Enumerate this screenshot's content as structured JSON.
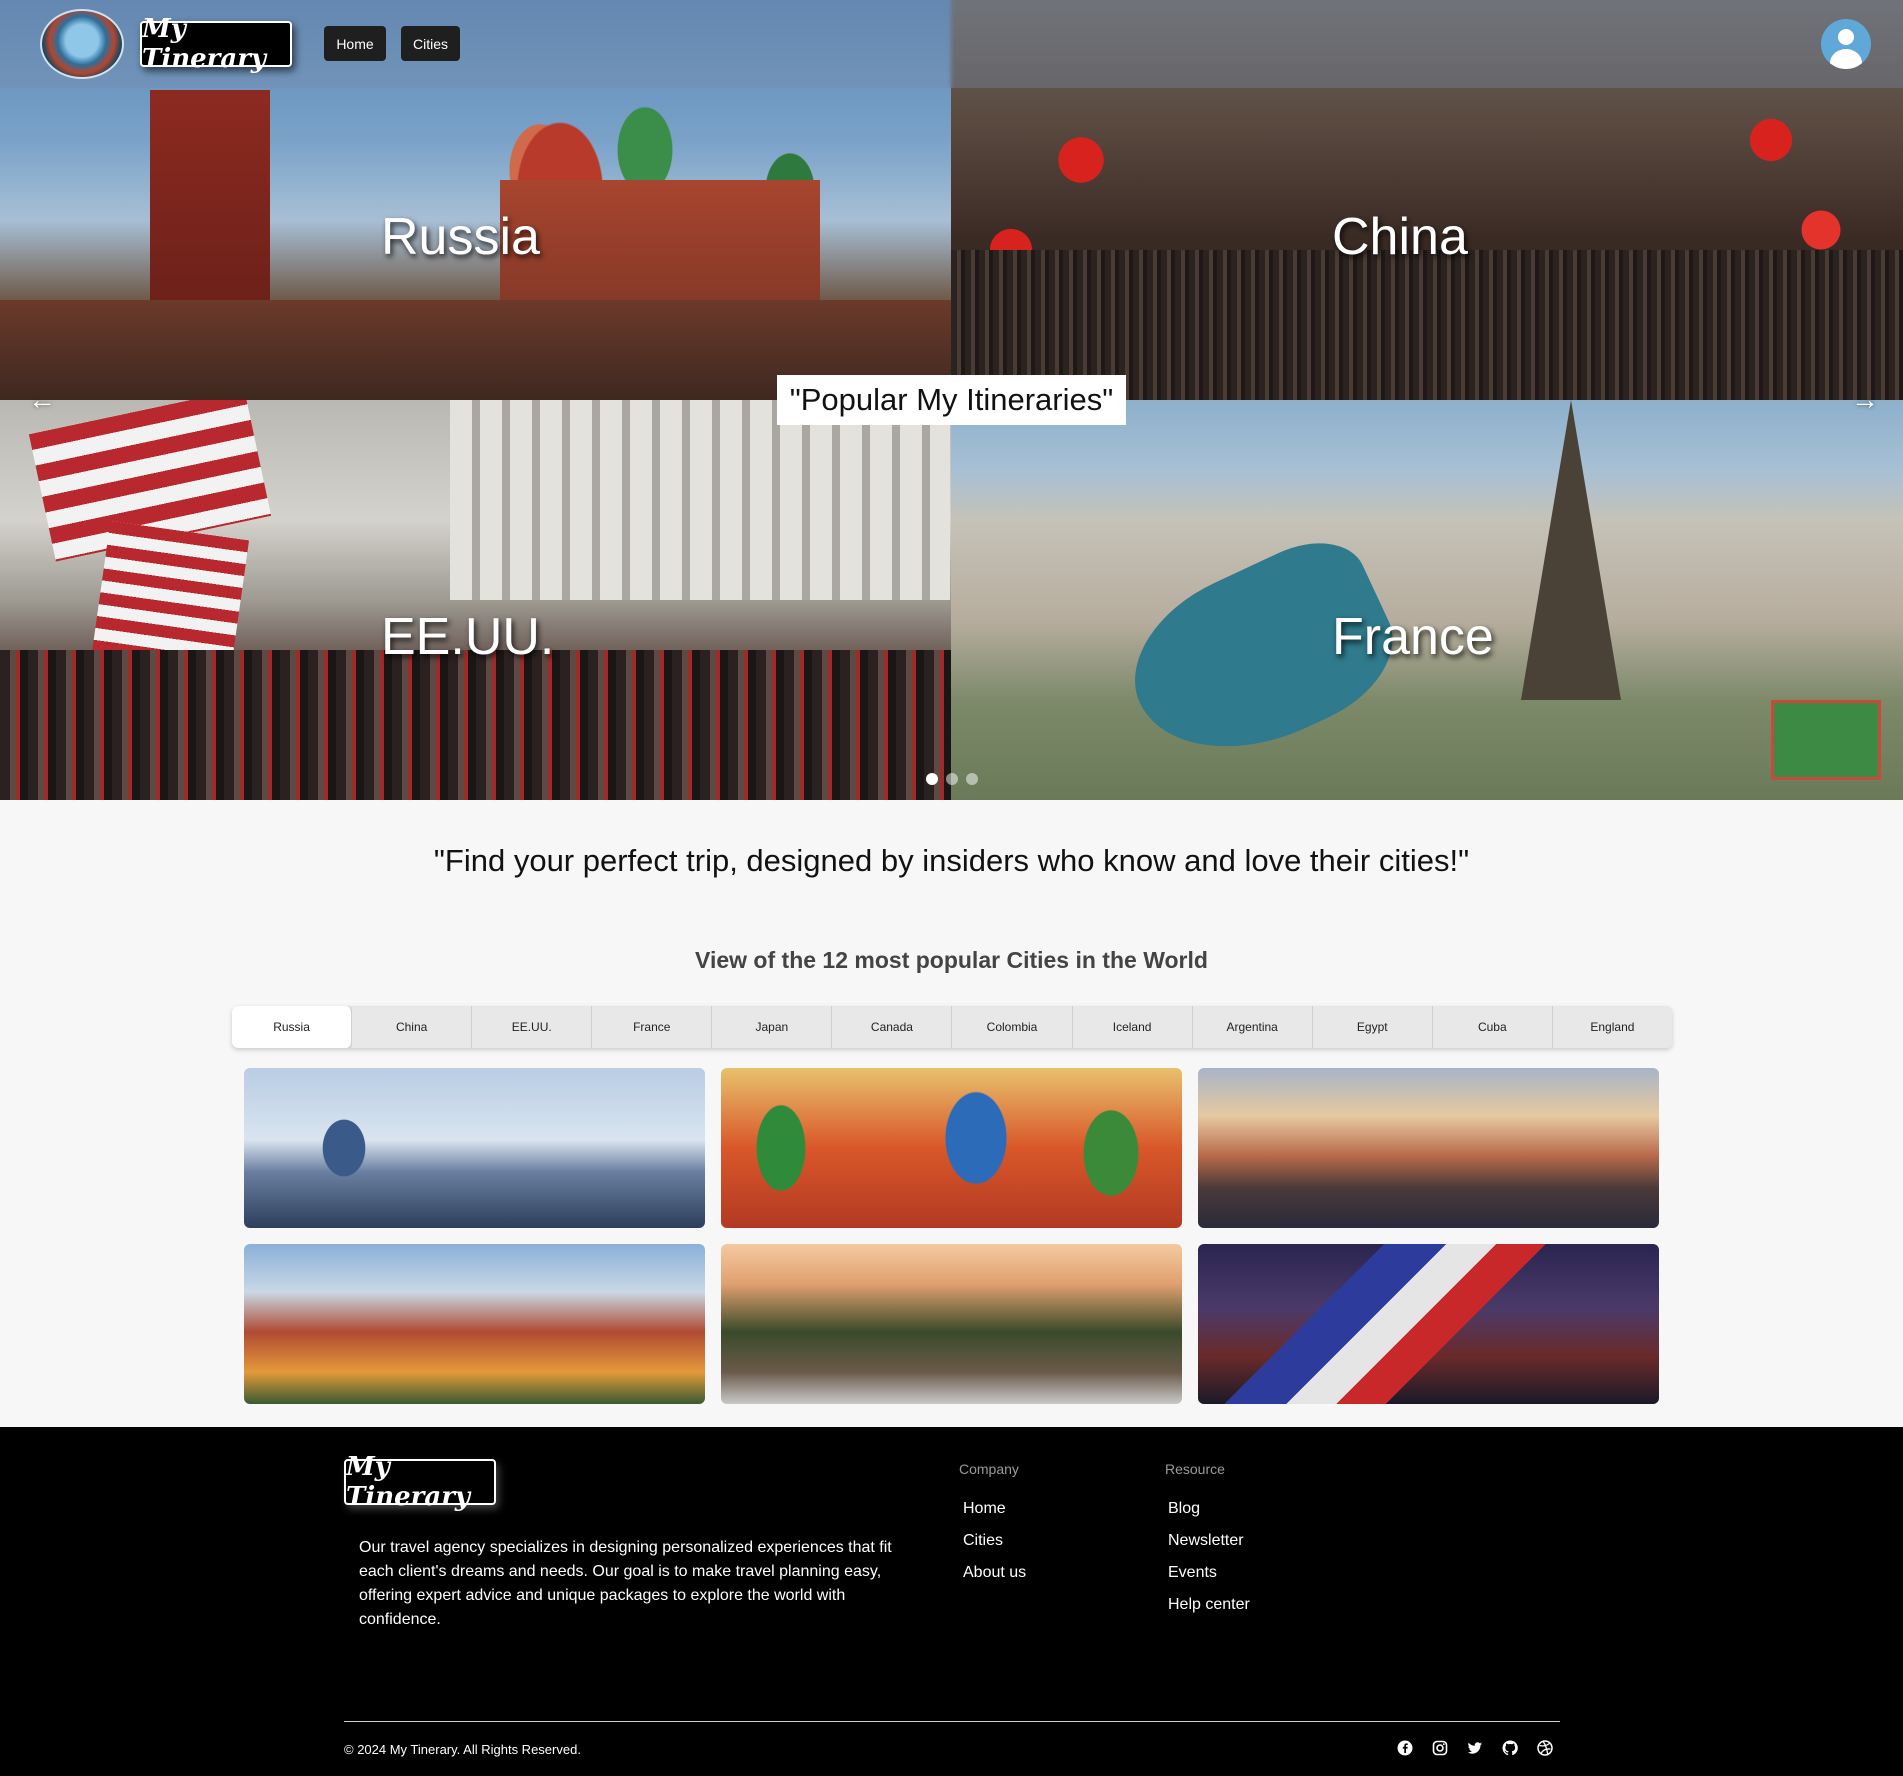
{
  "header": {
    "brand": "My Tinerary",
    "nav": [
      {
        "label": "Home"
      },
      {
        "label": "Cities"
      }
    ],
    "user_icon": "user-circle-icon"
  },
  "hero": {
    "caption": "\"Popular My Itineraries\"",
    "tiles": [
      {
        "label": "Russia"
      },
      {
        "label": "China"
      },
      {
        "label": "EE.UU."
      },
      {
        "label": "France"
      }
    ],
    "prev_icon": "arrow-left-icon",
    "next_icon": "arrow-right-icon",
    "slide_count": 3,
    "active_slide": 1
  },
  "main": {
    "tagline": "\"Find your perfect trip, designed by insiders who know and love their cities!\"",
    "section_title": "View of the 12 most popular Cities in the World",
    "tabs": [
      {
        "label": "Russia"
      },
      {
        "label": "China"
      },
      {
        "label": "EE.UU."
      },
      {
        "label": "France"
      },
      {
        "label": "Japan"
      },
      {
        "label": "Canada"
      },
      {
        "label": "Colombia"
      },
      {
        "label": "Iceland"
      },
      {
        "label": "Argentina"
      },
      {
        "label": "Egypt"
      },
      {
        "label": "Cuba"
      },
      {
        "label": "England"
      }
    ],
    "active_tab": "Russia"
  },
  "footer": {
    "brand": "My Tinerary",
    "description": "Our travel agency specializes in designing personalized experiences that fit each client's dreams and needs. Our goal is to make travel planning easy, offering expert advice and unique packages to explore the world with confidence.",
    "company_title": "Company",
    "company_links": [
      "Home",
      "Cities",
      "About us"
    ],
    "resource_title": "Resource",
    "resource_links": [
      "Blog",
      "Newsletter",
      "Events",
      "Help center"
    ],
    "copyright": "© 2024 My Tinerary. All Rights Reserved.",
    "social": [
      "facebook-icon",
      "instagram-icon",
      "twitter-icon",
      "github-icon",
      "dribbble-icon"
    ]
  }
}
